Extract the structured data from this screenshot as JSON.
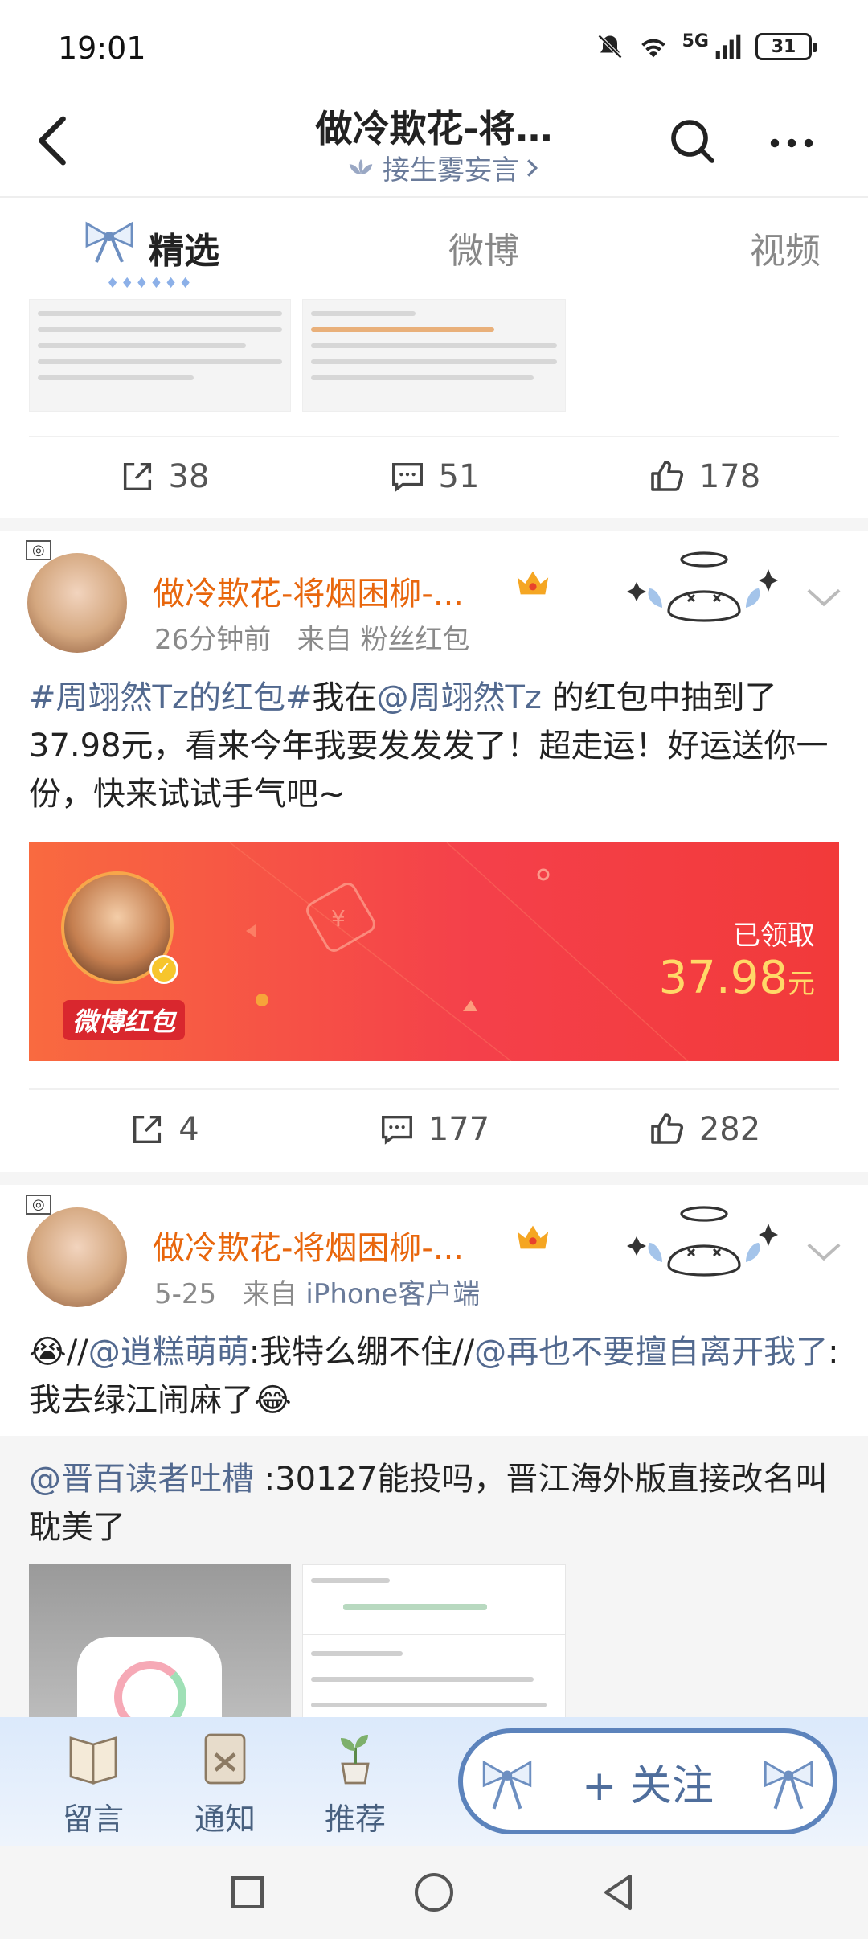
{
  "status_bar": {
    "time": "19:01",
    "network": "5G",
    "battery": "31"
  },
  "header": {
    "title": "做冷欺花-将…",
    "subtitle": "接生雾妄言"
  },
  "tabs": [
    {
      "label": "精选",
      "active": true
    },
    {
      "label": "微博",
      "active": false
    },
    {
      "label": "视频",
      "active": false
    }
  ],
  "post_prev": {
    "reposts": "38",
    "comments": "51",
    "likes": "178"
  },
  "post1": {
    "username": "做冷欺花-将烟困柳-...",
    "time": "26分钟前",
    "source_prefix": "来自",
    "source": "粉丝红包",
    "text_parts": {
      "topic": "#周翊然Tz的红包#",
      "p1": "我在",
      "mention": "@周翊然Tz",
      "p2": " 的红包中抽到了37.98元，看来今年我要发发发了！超走运！好运送你一份，快来试试手气吧~"
    },
    "redpacket": {
      "logo": "微博红包",
      "status": "已领取",
      "amount": "37.98",
      "unit": "元"
    },
    "reposts": "4",
    "comments": "177",
    "likes": "282"
  },
  "post2": {
    "username": "做冷欺花-将烟困柳-...",
    "time": "5-25",
    "source_prefix": "来自",
    "source": "iPhone客户端",
    "text_parts": {
      "emoji1": "😭",
      "s1": "//",
      "m1": "@逍糕萌萌",
      "t1": ":我特么绷不住//",
      "m2": "@再也不要擅自离开我了",
      "t2": ":我去绿江闹麻了",
      "emoji2": "😂"
    },
    "quote": {
      "mention": "@晋百读者吐槽",
      "text": " :30127能投吗，晋江海外版直接改名叫耽美了"
    }
  },
  "bottom_bar": {
    "items": [
      {
        "label": "留言"
      },
      {
        "label": "通知"
      },
      {
        "label": "推荐"
      }
    ],
    "follow": "+ 关注"
  },
  "colors": {
    "accent_orange": "#e8660c",
    "link_blue": "#52698f",
    "red_packet": "#f4404a"
  }
}
